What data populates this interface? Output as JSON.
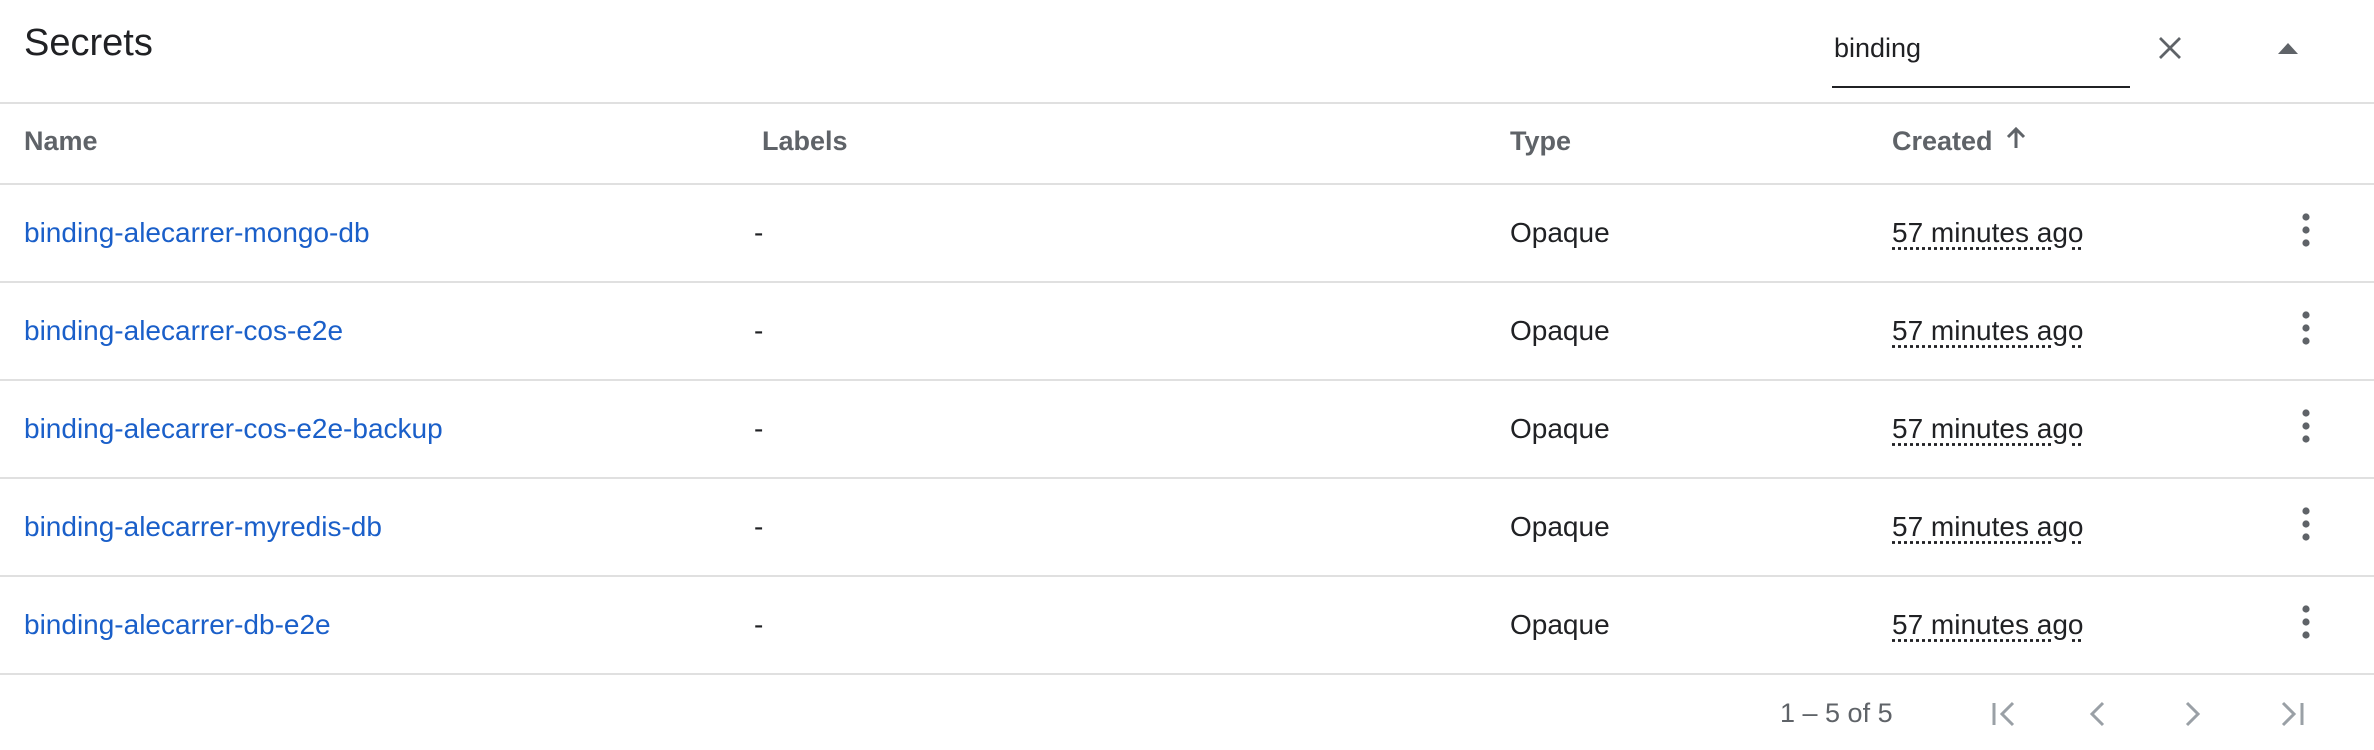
{
  "header": {
    "title": "Secrets",
    "search_value": "binding",
    "clear_icon": "close-icon",
    "collapse_icon": "arrow-drop-up-icon"
  },
  "columns": {
    "name": "Name",
    "labels": "Labels",
    "type": "Type",
    "created": "Created",
    "created_sort_icon": "arrow-upward-icon"
  },
  "rows": [
    {
      "name": "binding-alecarrer-mongo-db",
      "labels": "-",
      "type": "Opaque",
      "created": "57 minutes ago"
    },
    {
      "name": "binding-alecarrer-cos-e2e",
      "labels": "-",
      "type": "Opaque",
      "created": "57 minutes ago"
    },
    {
      "name": "binding-alecarrer-cos-e2e-backup",
      "labels": "-",
      "type": "Opaque",
      "created": "57 minutes ago"
    },
    {
      "name": "binding-alecarrer-myredis-db",
      "labels": "-",
      "type": "Opaque",
      "created": "57 minutes ago"
    },
    {
      "name": "binding-alecarrer-db-e2e",
      "labels": "-",
      "type": "Opaque",
      "created": "57 minutes ago"
    }
  ],
  "footer": {
    "range": "1 – 5 of 5",
    "icons": [
      "first-page-icon",
      "chevron-left-icon",
      "chevron-right-icon",
      "last-page-icon"
    ]
  },
  "colors": {
    "link": "#1a5fc9",
    "text": "#202124",
    "muted": "#5f6368",
    "divider": "#e0e0e0",
    "pager_icon": "#9aa0a6"
  }
}
